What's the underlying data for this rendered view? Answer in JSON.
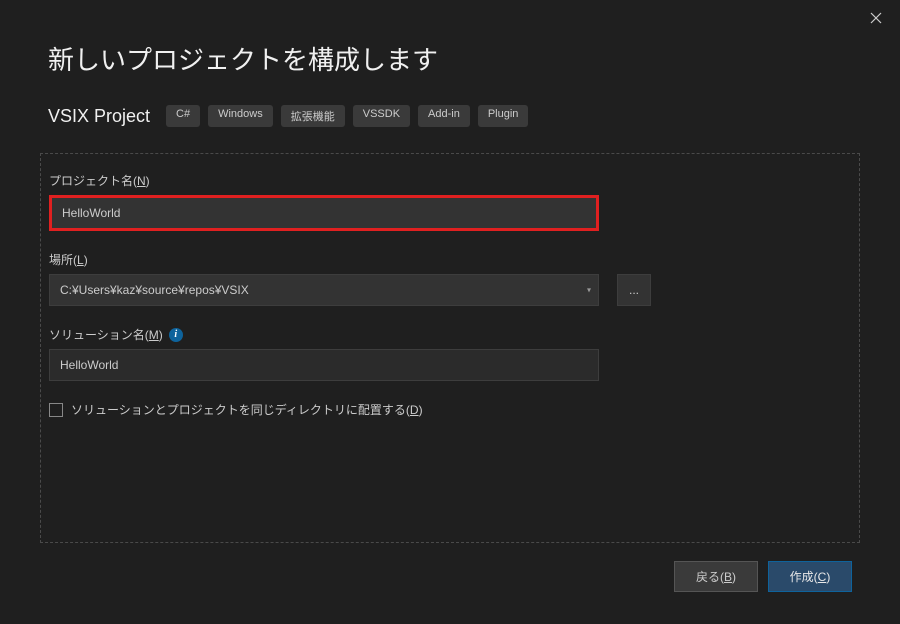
{
  "title": "新しいプロジェクトを構成します",
  "project_type": "VSIX Project",
  "tags": [
    "C#",
    "Windows",
    "拡張機能",
    "VSSDK",
    "Add-in",
    "Plugin"
  ],
  "fields": {
    "project_name": {
      "label_prefix": "プロジェクト名(",
      "label_accel": "N",
      "label_suffix": ")",
      "value": "HelloWorld"
    },
    "location": {
      "label_prefix": "場所(",
      "label_accel": "L",
      "label_suffix": ")",
      "value": "C:¥Users¥kaz¥source¥repos¥VSIX",
      "browse": "..."
    },
    "solution_name": {
      "label_prefix": "ソリューション名(",
      "label_accel": "M",
      "label_suffix": ")",
      "value": "HelloWorld"
    },
    "same_dir": {
      "label_prefix": "ソリューションとプロジェクトを同じディレクトリに配置する(",
      "label_accel": "D",
      "label_suffix": ")"
    }
  },
  "buttons": {
    "back_prefix": "戻る(",
    "back_accel": "B",
    "back_suffix": ")",
    "create_prefix": "作成(",
    "create_accel": "C",
    "create_suffix": ")"
  }
}
